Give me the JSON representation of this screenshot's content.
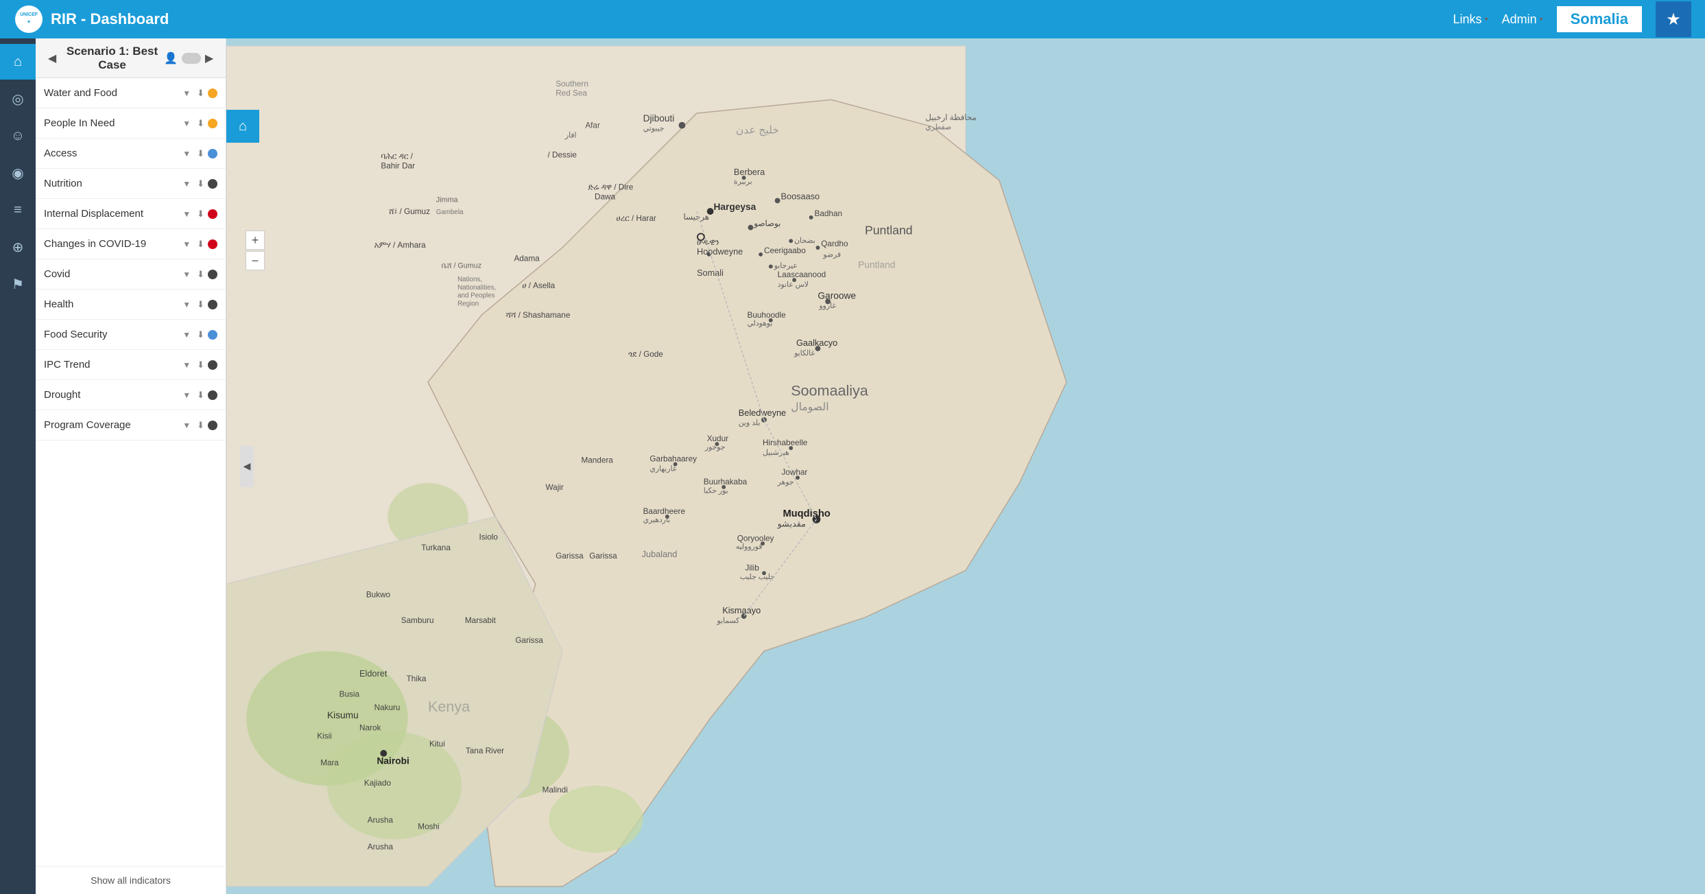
{
  "navbar": {
    "logo_text": "unicef",
    "divider": "|",
    "title": "RIR - Dashboard",
    "links_label": "Links",
    "admin_label": "Admin",
    "country": "Somalia",
    "star_icon": "★",
    "dropdown_arrow": "▾"
  },
  "scenario": {
    "title": "Scenario 1: Best Case",
    "prev_label": "◀",
    "next_label": "▶"
  },
  "indicators": [
    {
      "id": "water-food",
      "label": "Water and Food",
      "dot_class": "dot-yellow"
    },
    {
      "id": "people-in-need",
      "label": "People In Need",
      "dot_class": "dot-yellow"
    },
    {
      "id": "access",
      "label": "Access",
      "dot_class": "dot-blue"
    },
    {
      "id": "nutrition",
      "label": "Nutrition",
      "dot_class": "dot-dark"
    },
    {
      "id": "internal-displacement",
      "label": "Internal Displacement",
      "dot_class": "dot-red"
    },
    {
      "id": "changes-covid",
      "label": "Changes in COVID-19",
      "dot_class": "dot-red"
    },
    {
      "id": "covid",
      "label": "Covid",
      "dot_class": "dot-dark"
    },
    {
      "id": "health",
      "label": "Health",
      "dot_class": "dot-dark"
    },
    {
      "id": "food-security",
      "label": "Food Security",
      "dot_class": "dot-blue"
    },
    {
      "id": "ipc-trend",
      "label": "IPC Trend",
      "dot_class": "dot-dark"
    },
    {
      "id": "drought",
      "label": "Drought",
      "dot_class": "dot-dark"
    },
    {
      "id": "program-coverage",
      "label": "Program Coverage",
      "dot_class": "dot-dark"
    }
  ],
  "show_all_label": "Show all indicators",
  "icon_sidebar": [
    {
      "id": "home",
      "icon": "⌂",
      "active": true
    },
    {
      "id": "target",
      "icon": "◎",
      "active": false
    },
    {
      "id": "person",
      "icon": "☺",
      "active": false
    },
    {
      "id": "globe",
      "icon": "◉",
      "active": false
    },
    {
      "id": "layers",
      "icon": "≡",
      "active": false
    },
    {
      "id": "world",
      "icon": "⊕",
      "active": false
    },
    {
      "id": "flag",
      "icon": "⚑",
      "active": false
    }
  ],
  "map": {
    "home_icon": "⌂",
    "zoom_in": "+",
    "zoom_out": "−",
    "toggle_arrow": "◀"
  }
}
